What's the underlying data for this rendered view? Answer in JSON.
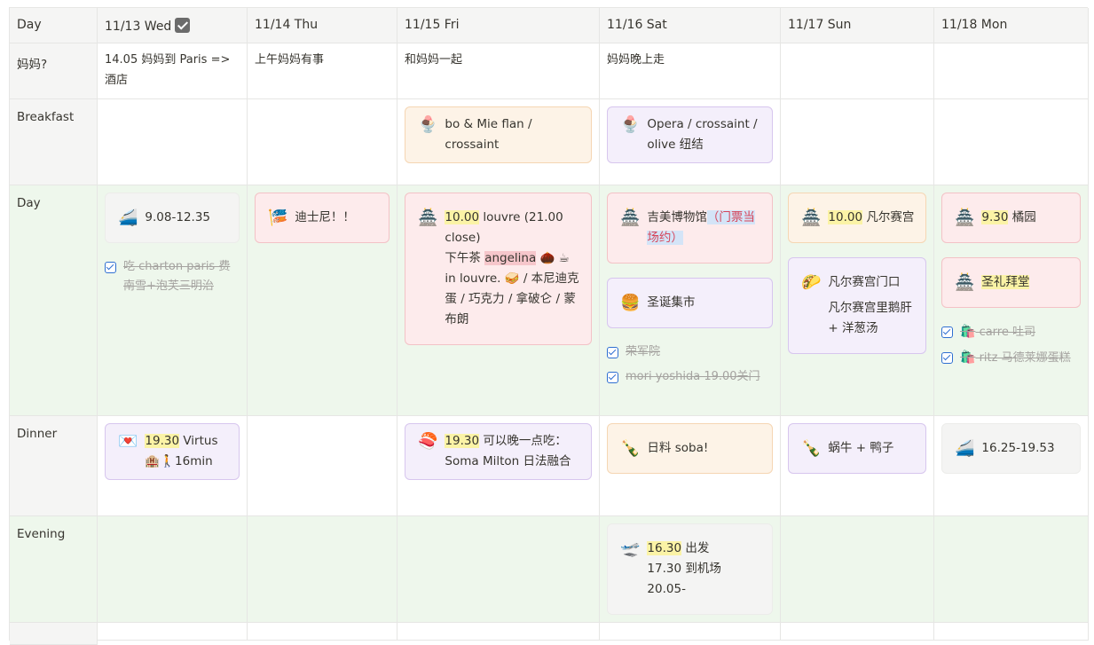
{
  "headers": [
    "Day",
    "11/13 Wed",
    "11/14 Thu",
    "11/15 Fri",
    "11/16 Sat",
    "11/17 Sun",
    "11/18 Mon"
  ],
  "rows": {
    "mom": {
      "label": "妈妈?",
      "wed": "14.05 妈妈到 Paris => 酒店",
      "thu": "上午妈妈有事",
      "fri": "和妈妈一起",
      "sat": "妈妈晚上走"
    },
    "breakfast": {
      "label": "Breakfast",
      "fri": {
        "icon": "🍨",
        "text": "bo & Mie flan / crossaint"
      },
      "sat": {
        "icon": "🍨",
        "text": "Opera / crossaint / olive 纽结"
      }
    },
    "day": {
      "label": "Day",
      "wed": {
        "card": {
          "icon": "🚄",
          "text": "9.08-12.35"
        },
        "todo": "吃 charton paris 费南雪+泡芙三明治"
      },
      "thu": {
        "icon": "🎏",
        "text": "迪士尼！！"
      },
      "fri": {
        "icon": "🏯",
        "time": "10.00",
        "line1": " louvre (21.00 close)",
        "line2a": "下午茶 ",
        "line2hl": "angelina",
        "line2b": " 🌰 ☕ in louvre. 🥪 / 本尼迪克蛋 / 巧克力 / 拿破仑 / 蒙布朗"
      },
      "sat": {
        "card1": {
          "icon": "🏯",
          "text": "吉美博物馆",
          "hl": "（门票当场约）"
        },
        "card2": {
          "icon": "🍔",
          "text": "圣诞集市"
        },
        "todo1": "荣军院",
        "todo2": "mori yoshida 19.00关门"
      },
      "sun": {
        "card1": {
          "icon": "🏯",
          "time": "10.00",
          "text": " 凡尔赛宫"
        },
        "card2": {
          "icon": "🌮",
          "text1": "凡尔赛宫门口",
          "text2": "凡尔赛宫里鹅肝 + 洋葱汤"
        }
      },
      "mon": {
        "card1": {
          "icon": "🏯",
          "time": "9.30",
          "text": " 橘园"
        },
        "card2": {
          "icon": "🏯",
          "hltext": "圣礼拜堂"
        },
        "todo1": {
          "icon": "🛍️",
          "text": " carre 吐司"
        },
        "todo2": {
          "icon": "🛍️",
          "text": " ritz 马德莱娜蛋糕"
        }
      }
    },
    "dinner": {
      "label": "Dinner",
      "wed": {
        "icon": "💌",
        "time": "19.30",
        "text": " Virtus",
        "line2": "🏨🚶16min"
      },
      "fri": {
        "icon": "🍣",
        "time": "19.30",
        "text": " 可以晚一点吃：Soma Milton 日法融合"
      },
      "sat": {
        "icon": "🍾",
        "text": "日料 soba!"
      },
      "sun": {
        "icon": "🍾",
        "text": "蜗牛 + 鸭子"
      },
      "mon": {
        "icon": "🚄",
        "text": "16.25-19.53"
      }
    },
    "evening": {
      "label": "Evening",
      "sat": {
        "icon": "🛫",
        "time": "16.30",
        "text": " 出发",
        "line2": "17.30 到机场",
        "line3": "20.05-"
      }
    }
  },
  "colors": {
    "pink_card": "#fdebec",
    "orange_card": "#fdf3e7",
    "purple_card": "#f4effb",
    "gray_card": "#f4f4f3",
    "green_row": "#eef7ec",
    "highlight_yellow": "#fbf3a6",
    "checkbox_blue": "#2f6fd1"
  }
}
